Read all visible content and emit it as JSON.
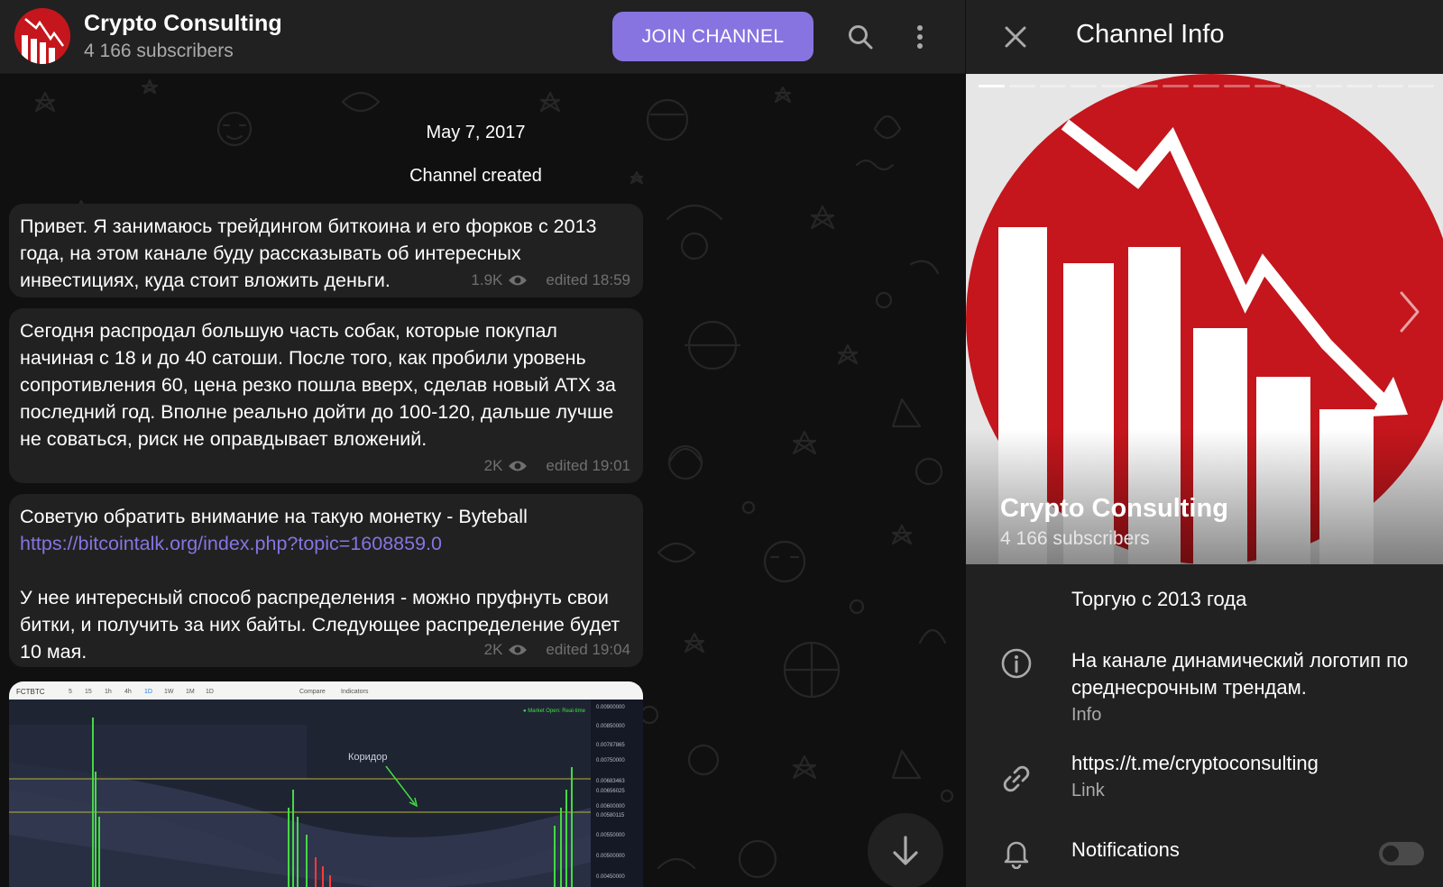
{
  "channel": {
    "name": "Crypto Consulting",
    "subscribers": "4 166 subscribers"
  },
  "header": {
    "join_label": "JOIN CHANNEL",
    "icons": [
      "search-icon",
      "more-vertical-icon"
    ]
  },
  "chat": {
    "date": "May 7, 2017",
    "service_message": "Channel created",
    "messages": [
      {
        "text": "Привет. Я занимаюсь трейдингом биткоина и его форков с 2013 года, на этом канале буду рассказывать об интересных инвестициях, куда стоит вложить деньги.",
        "views": "1.9K",
        "edited": "edited 18:59"
      },
      {
        "text": "Сегодня распродал большую часть собак, которые покупал начиная с 18 и до 40 сатоши. После того, как пробили уровень сопротивления 60, цена резко пошла вверх, сделав новый ATX за последний год. Вполне реально дойти до 100-120, дальше лучше не соваться, риск не оправдывает вложений.",
        "views": "2K",
        "edited": "edited 19:01"
      },
      {
        "text_before_link": "Советую обратить внимание на такую монетку - Byteball ",
        "link": "https://bitcointalk.org/index.php?topic=1608859.0",
        "text_after_link": "У нее интересный способ распределения - можно пруфнуть свои битки, и получить за них байты. Следующее распределение будет 10 мая.",
        "views": "2K",
        "edited": "edited 19:04"
      }
    ],
    "chart_image": {
      "symbol": "FCTBTC",
      "toolbar": [
        "5",
        "15",
        "1h",
        "4h",
        "1D",
        "1W",
        "1M",
        "1D",
        "Compare",
        "Indicators"
      ],
      "annotation": "Коридор",
      "market_status": "● Market Open: Real-time",
      "price_ticks": [
        "0.00900000",
        "0.00850000",
        "0.00787865",
        "0.00750000",
        "0.00683463",
        "0.00656025",
        "0.00600000",
        "0.00580115",
        "0.00550000",
        "0.00500000",
        "0.00450000"
      ]
    }
  },
  "info_panel": {
    "title": "Channel Info",
    "photo_count": 15,
    "active_photo": 1,
    "description": "Торгую с 2013 года",
    "about": "На канале динамический логотип по среднесрочным трендам.",
    "about_label": "Info",
    "link": "https://t.me/cryptoconsulting",
    "link_label": "Link",
    "notifications_label": "Notifications",
    "notifications_enabled": false
  },
  "colors": {
    "accent": "#8774e1",
    "logo_red": "#c4161c",
    "bubble": "#212121",
    "panel": "#212121"
  }
}
